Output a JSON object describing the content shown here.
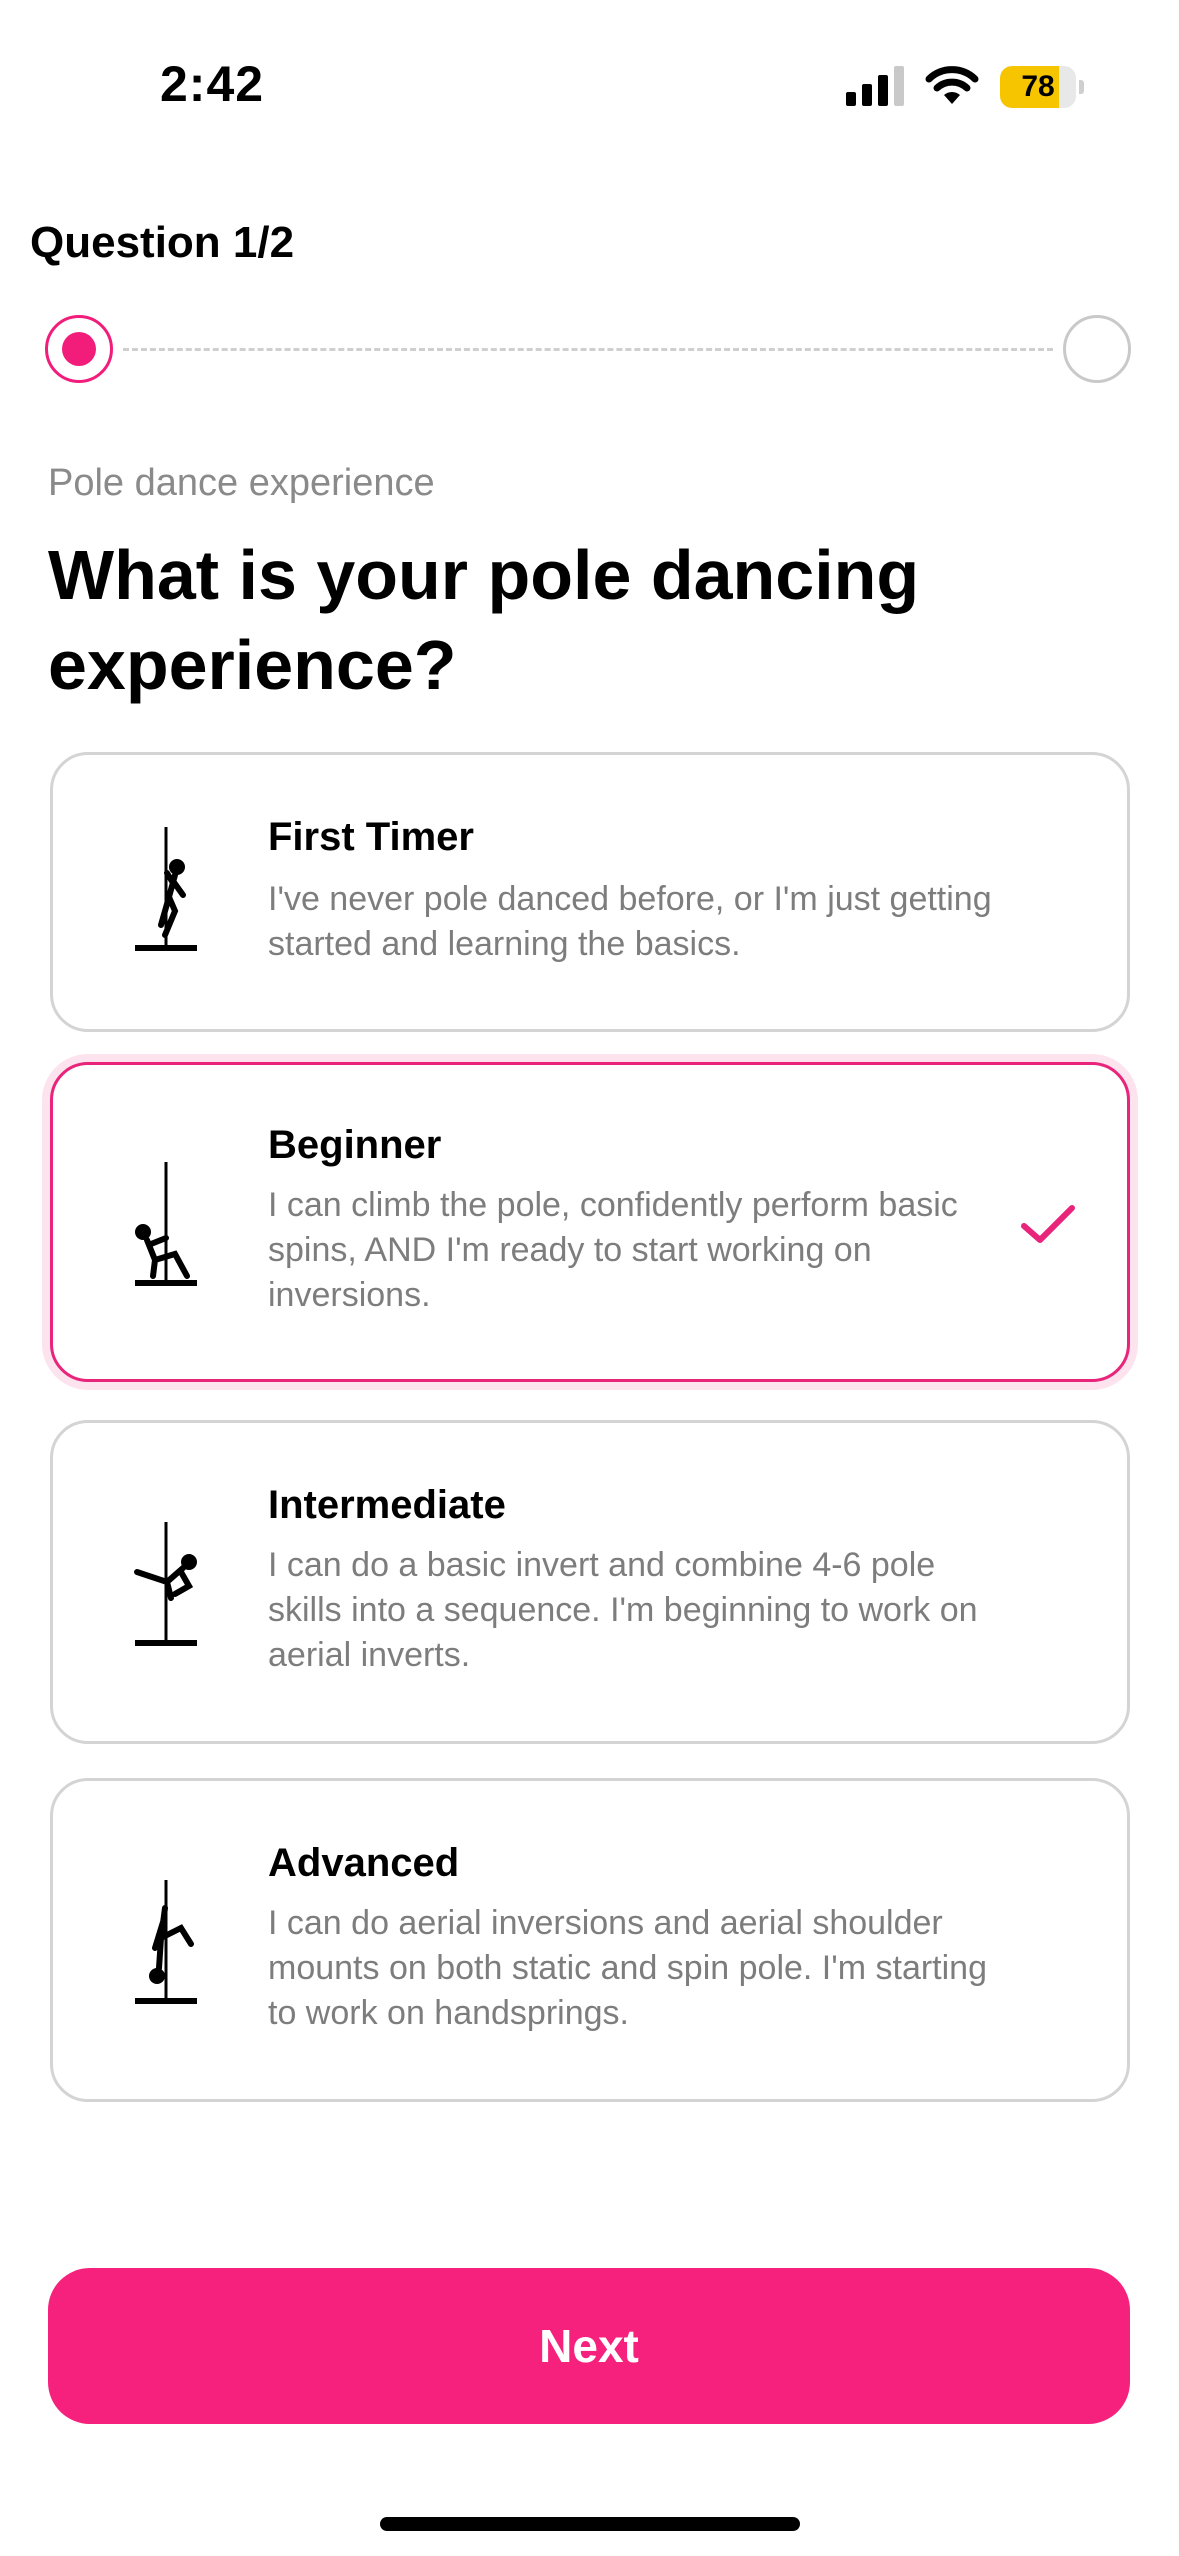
{
  "status_bar": {
    "time": "2:42",
    "battery_level": "78",
    "battery_fraction": 0.78,
    "battery_color": "#f7c500"
  },
  "header": {
    "question_counter": "Question 1/2",
    "current_step": 1,
    "total_steps": 2
  },
  "question": {
    "section_label": "Pole dance experience",
    "title": "What is your pole dancing experience?"
  },
  "options": [
    {
      "icon": "pole-first-timer-icon",
      "title": "First Timer",
      "description": "I've never pole danced before, or I'm just getting started and learning the basics.",
      "selected": false
    },
    {
      "icon": "pole-beginner-icon",
      "title": "Beginner",
      "description": "I can climb the pole, confidently perform basic spins, AND I'm ready to start working on inversions.",
      "selected": true
    },
    {
      "icon": "pole-intermediate-icon",
      "title": "Intermediate",
      "description": "I can do a basic invert and combine 4-6 pole skills into a sequence. I'm beginning to work on aerial inverts.",
      "selected": false
    },
    {
      "icon": "pole-advanced-icon",
      "title": "Advanced",
      "description": "I can do aerial inversions and aerial shoulder mounts on both static and spin pole. I'm starting to work on handsprings.",
      "selected": false
    }
  ],
  "next_button": {
    "label": "Next"
  },
  "colors": {
    "accent": "#f5217d",
    "selected_border": "#e8247b",
    "description_text": "#7d7d7d"
  }
}
